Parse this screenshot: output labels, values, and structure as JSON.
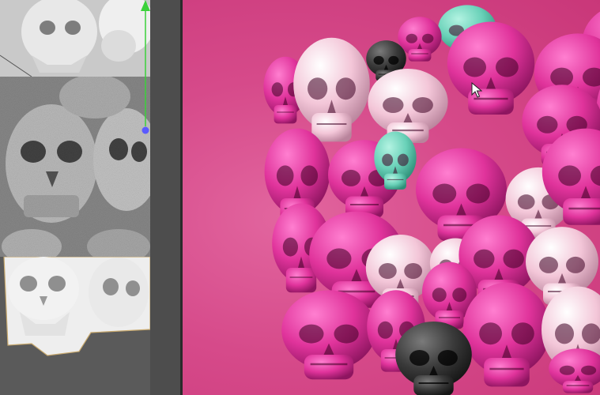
{
  "colors": {
    "background_pink": "#d64a8a",
    "skull_magenta": "#e0339b",
    "skull_light_pink": "#f3c6d8",
    "skull_teal": "#69d1b8",
    "skull_dark": "#3a3a3a",
    "axis_green": "#3ad13a",
    "axis_blue": "#5a5aff"
  },
  "icons": {
    "cursor": "mouse-pointer-icon",
    "axis_handle": "axis-gizmo-icon"
  }
}
